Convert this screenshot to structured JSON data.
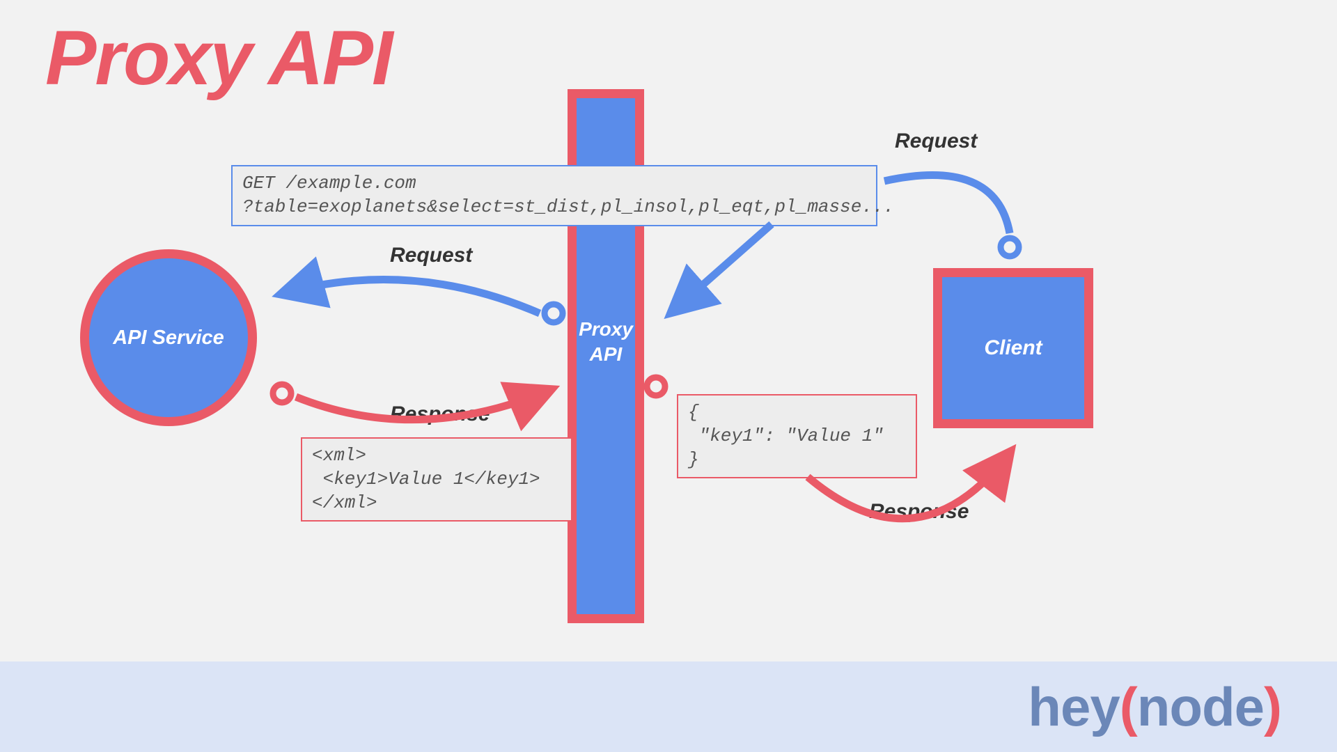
{
  "title": "Proxy API",
  "nodes": {
    "api_service": "API Service",
    "proxy": "Proxy\nAPI",
    "client": "Client"
  },
  "labels": {
    "request_left": "Request",
    "response_left": "Response",
    "request_right": "Request",
    "response_right": "Response"
  },
  "code": {
    "get_request": "GET /example.com\n?table=exoplanets&select=st_dist,pl_insol,pl_eqt,pl_masse...",
    "xml_response": "<xml>\n <key1>Value 1</key1>\n</xml>",
    "json_response": "{\n \"key1\": \"Value 1\"\n}"
  },
  "brand": {
    "hey": "hey",
    "open": "(",
    "node": "node",
    "close": ")"
  },
  "colors": {
    "blue": "#5a8cea",
    "red": "#ea5a67",
    "bg": "#f2f2f2",
    "footer": "#dbe4f6"
  }
}
